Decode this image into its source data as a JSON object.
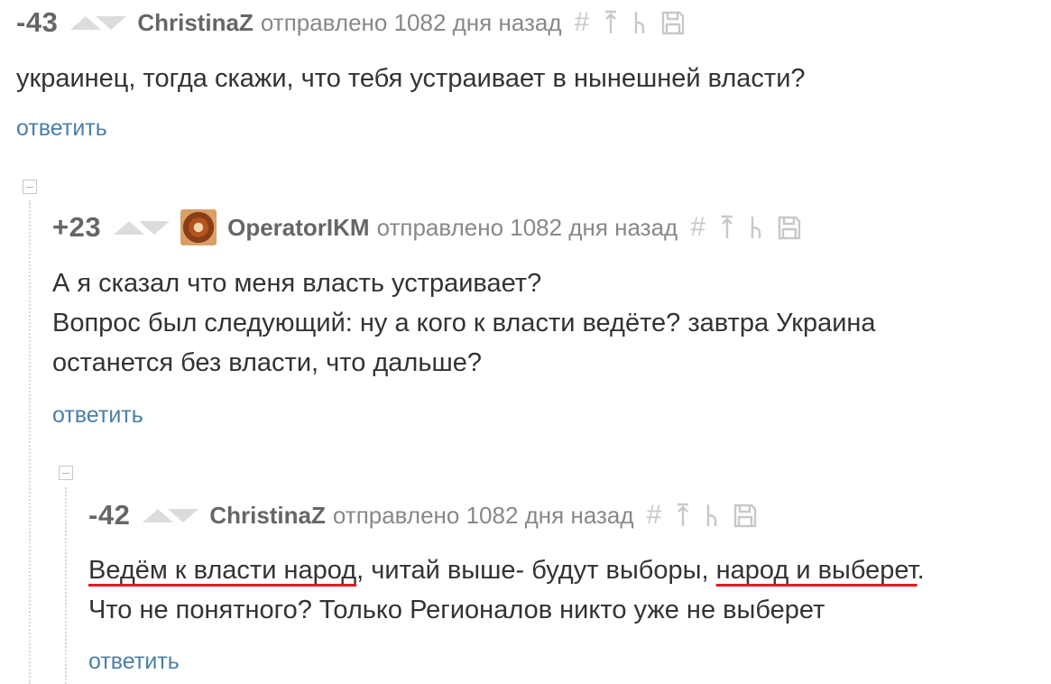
{
  "comments": [
    {
      "rating": "-43",
      "author": "ChristinaZ",
      "sent": "отправлено 1082 дня назад",
      "lines": [
        "украинец, тогда скажи, что тебя устраивает в нынешней власти?"
      ],
      "reply_label": "ответить"
    },
    {
      "rating": "+23",
      "author": "OperatorIKM",
      "sent": "отправлено 1082 дня назад",
      "lines": [
        "А я сказал что меня власть устраивает?",
        "Вопрос был следующий: ну а кого к власти ведёте? завтра Украина",
        "останется без власти, что дальше?"
      ],
      "reply_label": "ответить"
    },
    {
      "rating": "-42",
      "author": "ChristinaZ",
      "sent": "отправлено 1082 дня назад",
      "line1_parts": [
        "Ведём к власти народ",
        ", читай выше- будут выборы, ",
        "народ и выберет",
        "."
      ],
      "line2": "Что не понятного? Только Регионалов никто уже не выберет",
      "reply_label": "ответить"
    }
  ],
  "tools": {
    "hash": "#"
  },
  "icons": [
    "arrow-up-bar-icon",
    "branch-icon",
    "save-icon",
    "collapse-icon"
  ],
  "colors": {
    "link": "#4a7fa6",
    "underline": "#e01b24"
  }
}
